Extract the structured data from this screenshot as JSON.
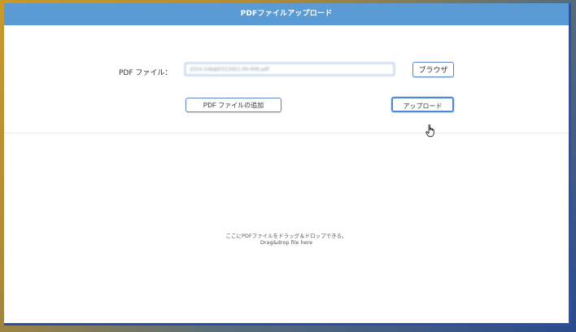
{
  "window": {
    "title": "PDFファイルアップロード"
  },
  "form": {
    "file_label": "PDF ファイル：",
    "file_value": "2024-24b@D313451-00-006.pdf",
    "browse_label": "ブラウザ",
    "add_label": "PDF ファイルの追加",
    "upload_label": "アップロード"
  },
  "drop_zone": {
    "text_jp": "ここにPDFファイルをドラッグ＆ドロップできる。",
    "text_en": "Drag&drop file here"
  },
  "colors": {
    "titlebar": "#5b9bd5",
    "button_border": "#5b86c8",
    "input_border": "#7fa8d8"
  }
}
